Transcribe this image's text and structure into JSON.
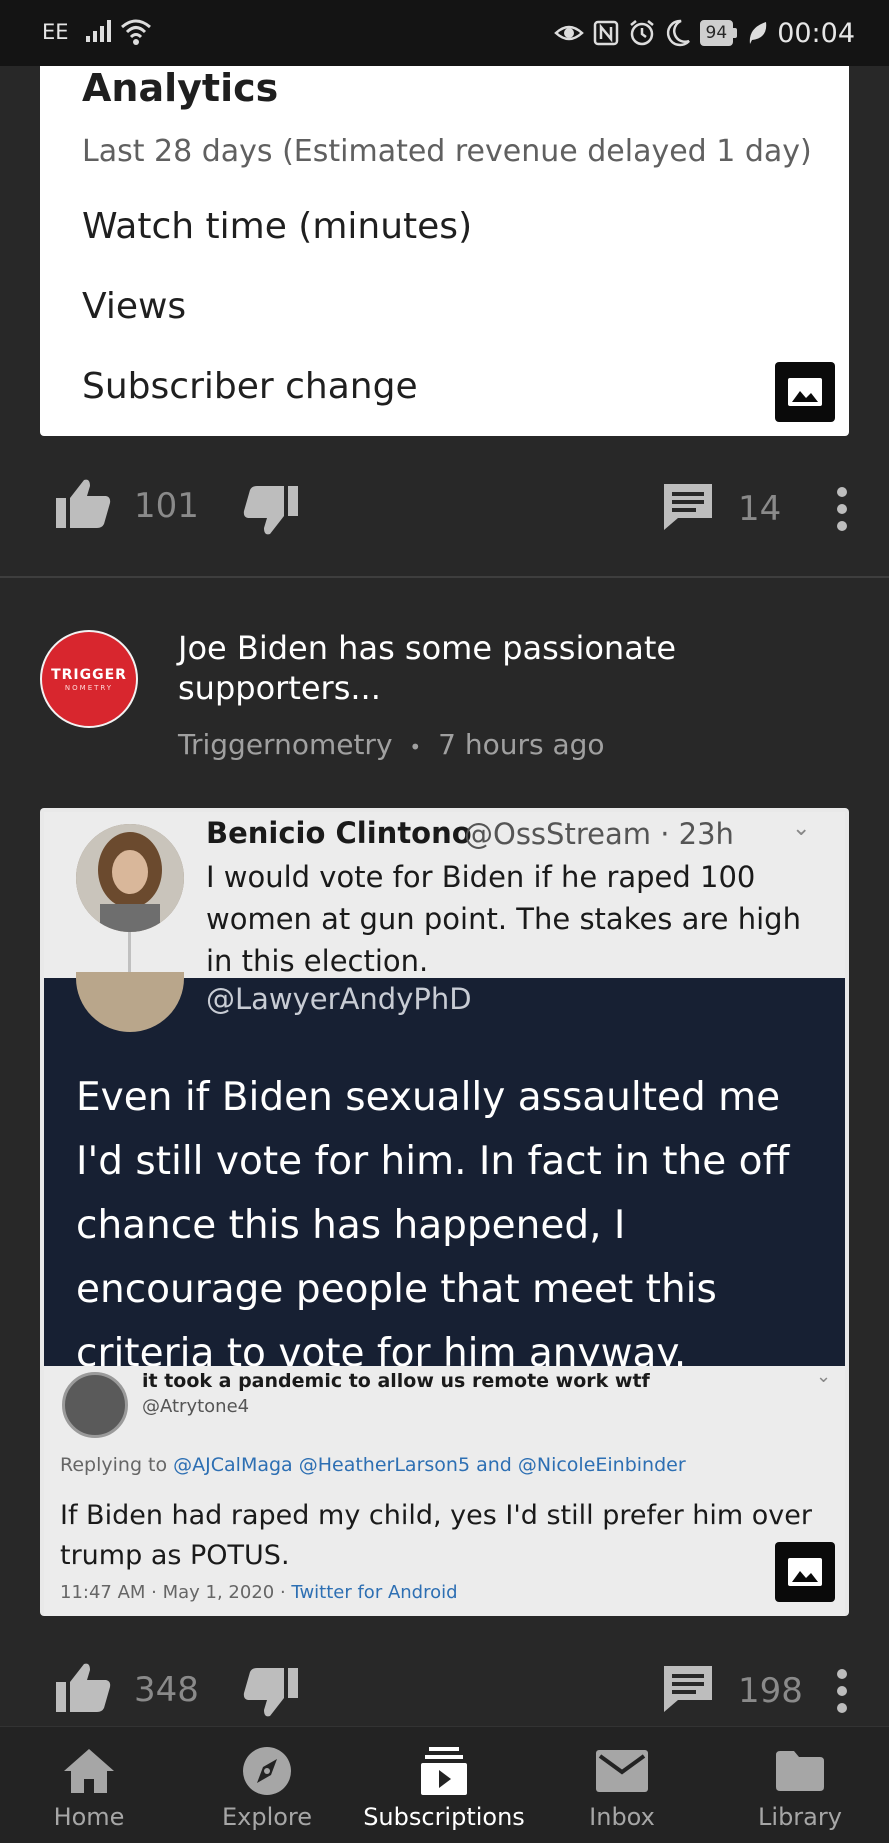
{
  "status_bar": {
    "carrier": "EE",
    "battery": "94",
    "time": "00:04",
    "icons": [
      "signal-icon",
      "wifi-icon",
      "eye-icon",
      "nfc-icon",
      "alarm-icon",
      "moon-icon",
      "battery-icon",
      "leaf-icon"
    ]
  },
  "analytics_card": {
    "title": "Analytics",
    "subtitle": "Last 28 days (Estimated revenue delayed 1 day)",
    "items": [
      "Watch time (minutes)",
      "Views",
      "Subscriber change"
    ]
  },
  "post1_actions": {
    "likes": "101",
    "comments": "14"
  },
  "post2": {
    "avatar_text": "TRIGGER",
    "avatar_subtext": "NOMETRY",
    "title": "Joe Biden has some passionate supporters...",
    "channel": "Triggernometry",
    "separator": "•",
    "age": "7 hours ago",
    "image": {
      "tweet1": {
        "name": "Benicio Clintono",
        "handle": "@OssStream · 23h",
        "text": "I would vote for Biden if he raped 100 women at gun point. The stakes are high in this election."
      },
      "tweet2": {
        "handle": "@LawyerAndyPhD",
        "text": "Even if Biden sexually assaulted me I'd still vote for him. In fact in the off chance this has happened, I encourage people that meet this criteria to vote for him anyway."
      },
      "tweet3": {
        "name": "it took a pandemic to allow us remote work wtf",
        "handle": "@Atrytone4",
        "reply_prefix": "Replying to ",
        "reply_mentions": "@AJCalMaga @HeatherLarson5 and @NicoleEinbinder",
        "text": "If Biden had raped my child, yes I'd still prefer him over trump as POTUS.",
        "time": "11:47 AM · May 1, 2020 · ",
        "app": "Twitter for Android"
      }
    }
  },
  "post2_actions": {
    "likes": "348",
    "comments": "198"
  },
  "bottom_nav": {
    "items": [
      {
        "label": "Home",
        "icon": "home-icon"
      },
      {
        "label": "Explore",
        "icon": "compass-icon"
      },
      {
        "label": "Subscriptions",
        "icon": "subscriptions-icon",
        "active": true
      },
      {
        "label": "Inbox",
        "icon": "mail-icon"
      },
      {
        "label": "Library",
        "icon": "folder-icon"
      }
    ]
  },
  "colors": {
    "background": "#282828",
    "status_bar": "#141414",
    "card": "#ffffff",
    "avatar_red": "#d8262e",
    "tweet_dark": "#172033"
  }
}
